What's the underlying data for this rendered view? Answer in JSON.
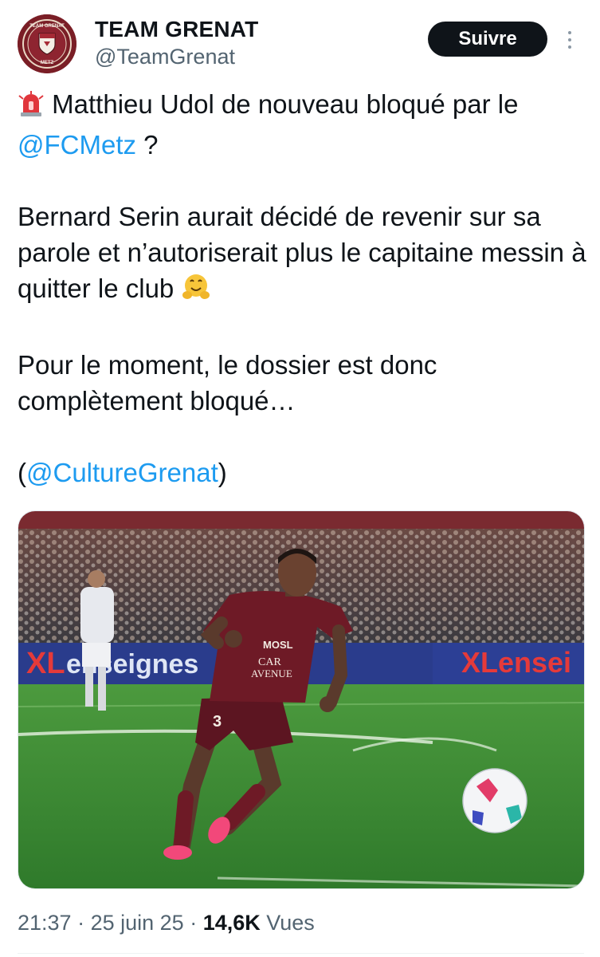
{
  "account": {
    "display_name": "TEAM GRENAT",
    "handle": "@TeamGrenat",
    "avatar_text_top": "TEAM GRENAT",
    "avatar_text_bottom": "METZ",
    "avatar_color": "#7a1e26"
  },
  "follow_button": {
    "label": "Suivre"
  },
  "more_menu": {
    "icon": "more-vertical-icon"
  },
  "tweet": {
    "line1_emoji": "siren-icon",
    "line1_text": " Matthieu Udol de nouveau bloqué par le",
    "mention_fcmetz": "@FCMetz",
    "line2_suffix": " ?",
    "paragraph2": "Bernard Serin aurait décidé de revenir sur sa parole et n’autoriserait plus le capitaine messin à quitter le club",
    "paragraph2_emoji": "hugging-face-icon",
    "paragraph3": "Pour le moment, le dossier est donc complètement bloqué…",
    "source_open": "(",
    "mention_source": "@CultureGrenat",
    "source_close": ")"
  },
  "media": {
    "description_icon": "football-player-photo",
    "board_text_left": "enseignes",
    "board_text_right": "XLensei",
    "shirt_sponsor": "MOSL CAR AVENUE",
    "colors": {
      "shirt": "#6e1a26",
      "pitch": "#3f8f35",
      "board": "#2a3c8c"
    }
  },
  "meta": {
    "time": "21:37",
    "sep1": " · ",
    "date": "25 juin 25",
    "sep2": " · ",
    "views_count": "14,6K",
    "views_label": " Vues"
  },
  "colors": {
    "link": "#1d9bf0",
    "text": "#0f1419",
    "secondary": "#536471",
    "button_bg": "#0f1419"
  }
}
